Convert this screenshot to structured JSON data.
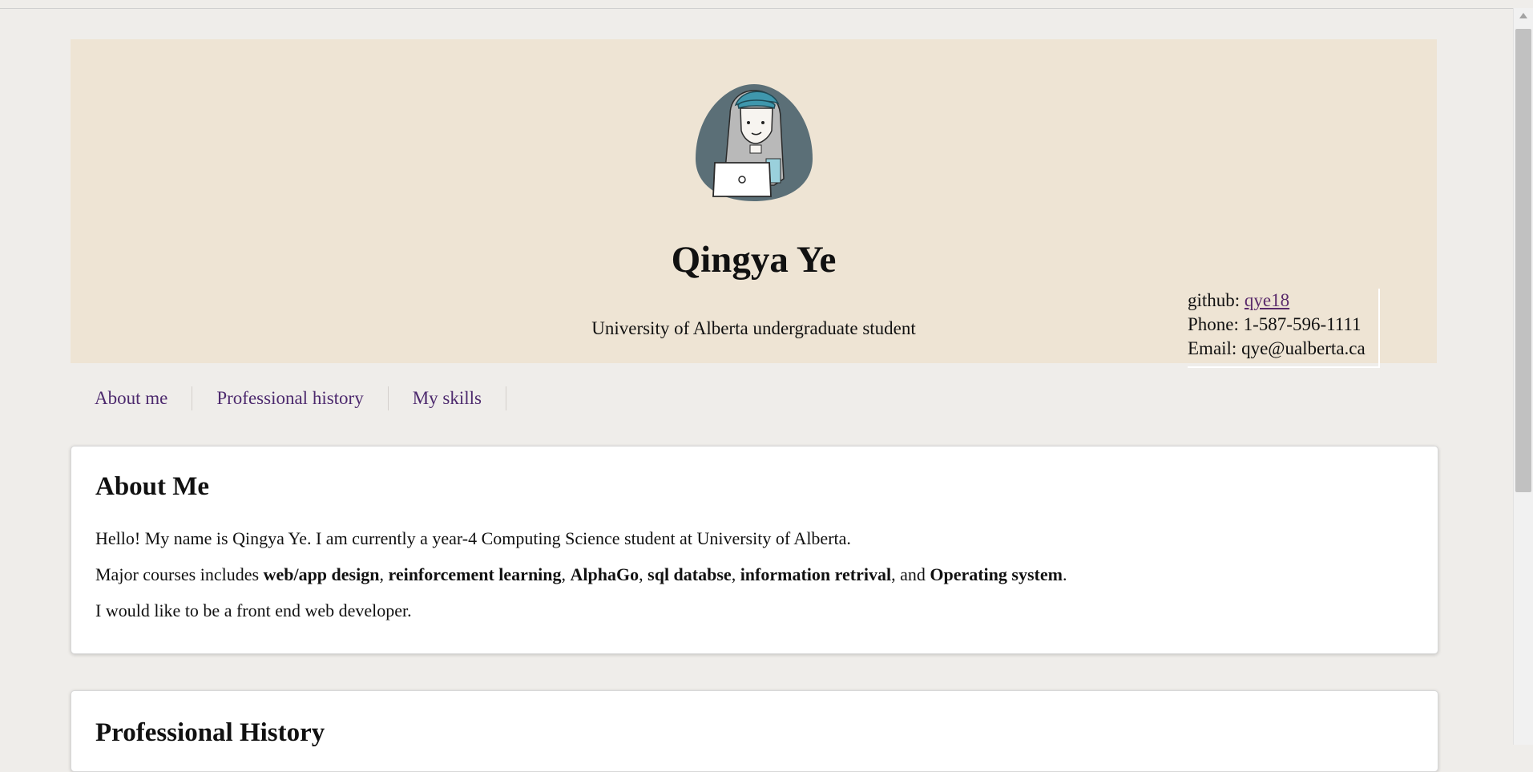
{
  "header": {
    "name": "Qingya Ye",
    "subtitle": "University of Alberta undergraduate student",
    "contact": {
      "github_label": "github: ",
      "github_link": "qye18",
      "phone": "Phone: 1-587-596-1111",
      "email": "Email: qye@ualberta.ca"
    }
  },
  "nav": {
    "items": [
      {
        "label": "About me"
      },
      {
        "label": "Professional history"
      },
      {
        "label": "My skills"
      }
    ]
  },
  "about": {
    "title": "About Me",
    "line1": "Hello! My name is Qingya Ye. I am currently a year-4 Computing Science student at University of Alberta.",
    "line2_prefix": "Major courses includes ",
    "courses": [
      "web/app design",
      "reinforcement learning",
      "AlphaGo",
      "sql databse",
      "information retrival",
      "Operating system"
    ],
    "line2_and": ", and ",
    "line2_sep": ", ",
    "line2_suffix": ".",
    "line3": "I would like to be a front end web developer."
  },
  "professional": {
    "title": "Professional History"
  },
  "colors": {
    "page_bg": "#efedea",
    "header_bg": "#eee4d4",
    "link": "#5a2a6b",
    "avatar_bg": "#5b6f77",
    "hat": "#3f97ad"
  }
}
